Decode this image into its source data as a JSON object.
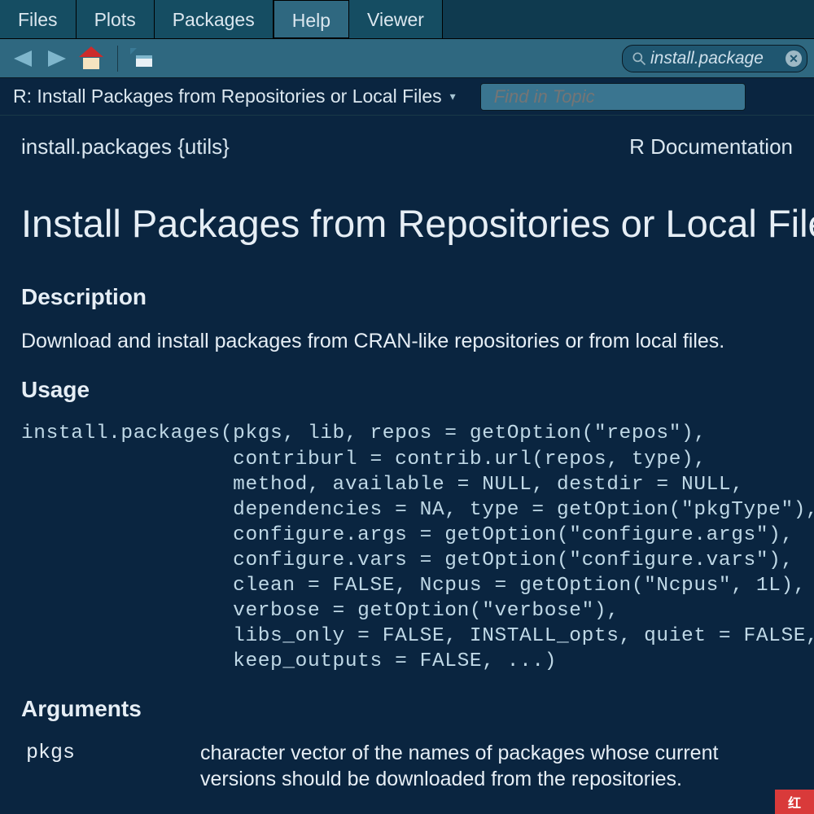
{
  "tabs": {
    "items": [
      "Files",
      "Plots",
      "Packages",
      "Help",
      "Viewer"
    ],
    "activeIndex": 3
  },
  "toolbar": {
    "back": "Back",
    "forward": "Forward",
    "home": "Home",
    "popout": "Open in new window"
  },
  "search": {
    "value": "install.package",
    "placeholder": ""
  },
  "crumb": {
    "title": "R: Install Packages from Repositories or Local Files",
    "find_topic_placeholder": "Find in Topic"
  },
  "doc": {
    "topic": "install.packages {utils}",
    "rightLabel": "R Documentation",
    "title": "Install Packages from Repositories or Local Files",
    "sections": {
      "description": "Description",
      "usage": "Usage",
      "arguments": "Arguments"
    },
    "descriptionText": "Download and install packages from CRAN-like repositories or from local files.",
    "usageCode": "install.packages(pkgs, lib, repos = getOption(\"repos\"),\n                 contriburl = contrib.url(repos, type),\n                 method, available = NULL, destdir = NULL,\n                 dependencies = NA, type = getOption(\"pkgType\"),\n                 configure.args = getOption(\"configure.args\"),\n                 configure.vars = getOption(\"configure.vars\"),\n                 clean = FALSE, Ncpus = getOption(\"Ncpus\", 1L),\n                 verbose = getOption(\"verbose\"),\n                 libs_only = FALSE, INSTALL_opts, quiet = FALSE,\n                 keep_outputs = FALSE, ...)",
    "args": [
      {
        "name": "pkgs",
        "desc": "character vector of the names of packages whose current versions should be downloaded from the repositories."
      }
    ]
  },
  "cornerMark": "红"
}
